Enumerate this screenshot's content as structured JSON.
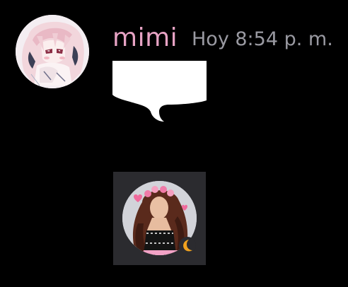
{
  "message": {
    "author": {
      "name": "mimi",
      "name_color": "#e7a3c4"
    },
    "timestamp": "Hoy 8:54 p. m.",
    "timestamp_color": "#9a9aa2",
    "content": {
      "sticker": "white-speech-bubble",
      "attachment": {
        "type": "profile-picture-image",
        "status_icon": "moon-icon",
        "status_color": "#f0a21f"
      }
    }
  },
  "theme": {
    "background": "#000000",
    "attachment_bg": "#2b2b2f"
  }
}
